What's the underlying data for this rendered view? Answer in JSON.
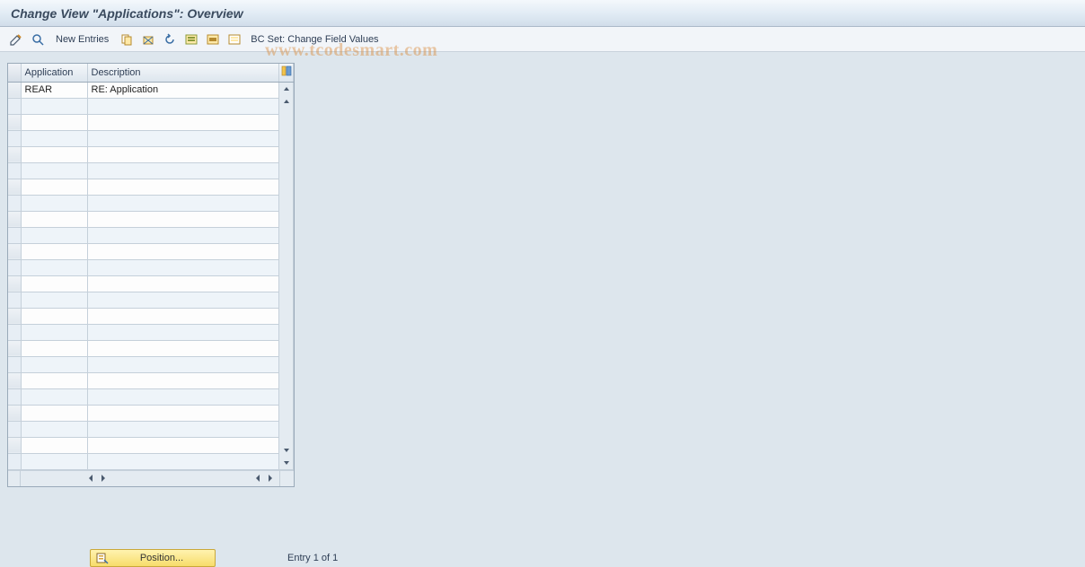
{
  "title": "Change View \"Applications\": Overview",
  "toolbar": {
    "new_entries": "New Entries",
    "bc_set_label": "BC Set: Change Field Values"
  },
  "table": {
    "columns": {
      "application": "Application",
      "description": "Description"
    },
    "rows": [
      {
        "application": "REAR",
        "description": "RE: Application"
      }
    ],
    "empty_row_count": 23
  },
  "footer": {
    "position_label": "Position...",
    "entry_text": "Entry 1 of 1"
  },
  "watermark": "www.tcodesmart.com"
}
